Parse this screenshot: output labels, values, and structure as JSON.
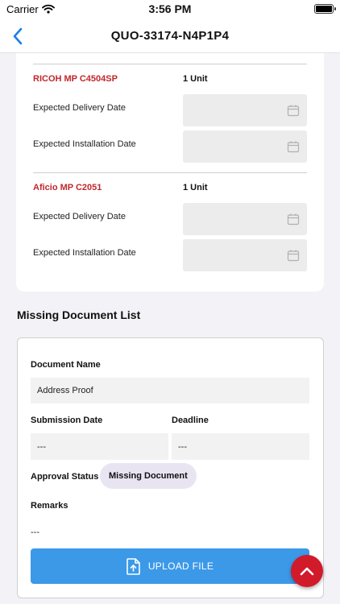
{
  "status_bar": {
    "carrier": "Carrier",
    "time": "3:56 PM"
  },
  "nav": {
    "title": "QUO-33174-N4P1P4"
  },
  "products": [
    {
      "name": "RICOH MP C4504SP",
      "qty": "1 Unit",
      "delivery_label": "Expected Delivery Date",
      "install_label": "Expected Installation Date"
    },
    {
      "name": "Aficio MP C2051",
      "qty": "1 Unit",
      "delivery_label": "Expected Delivery Date",
      "install_label": "Expected Installation Date"
    }
  ],
  "missing_docs": {
    "title": "Missing Document List",
    "document_name_label": "Document Name",
    "document_name_value": "Address Proof",
    "submission_date_label": "Submission Date",
    "submission_date_value": "---",
    "deadline_label": "Deadline",
    "deadline_value": "---",
    "approval_status_label": "Approval Status",
    "approval_status_value": "Missing Document",
    "remarks_label": "Remarks",
    "remarks_value": "---",
    "upload_label": "UPLOAD FILE"
  },
  "colors": {
    "accent": "#3c99e8",
    "product_name": "#c1272d",
    "fab": "#d11a2a",
    "chip": "#e9e4f2"
  },
  "icons": {
    "back": "chevron-left-icon",
    "calendar": "calendar-icon",
    "upload": "file-upload-icon",
    "scroll_top": "chevron-up-icon"
  }
}
